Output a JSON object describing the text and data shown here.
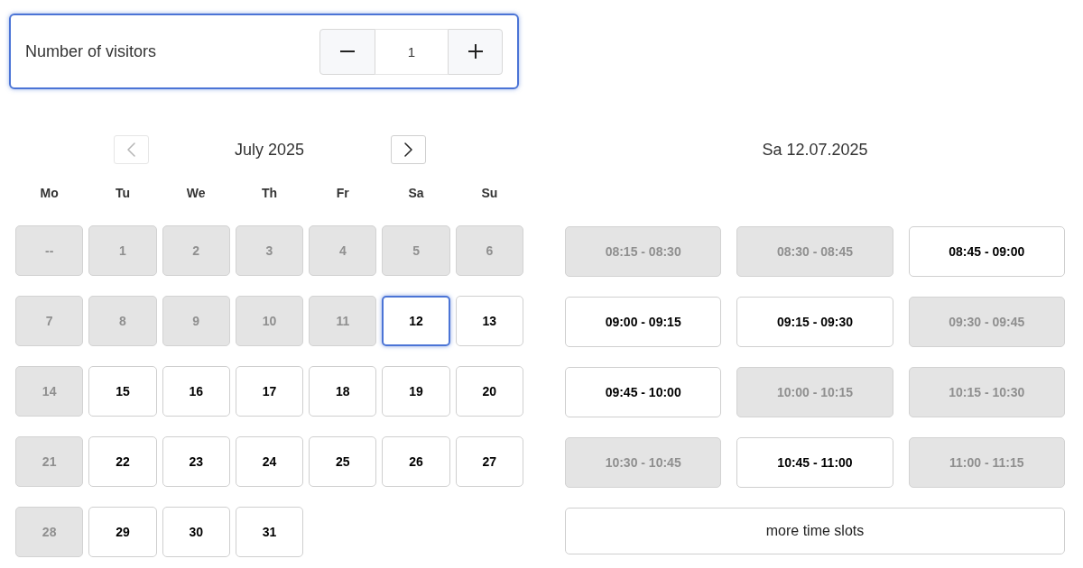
{
  "visitors": {
    "label": "Number of visitors",
    "value": "1",
    "focused": true
  },
  "calendar": {
    "month": "July 2025",
    "prev_disabled": true,
    "next_disabled": false,
    "weekdays": [
      "Mo",
      "Tu",
      "We",
      "Th",
      "Fr",
      "Sa",
      "Su"
    ],
    "weeks": [
      [
        {
          "label": "--",
          "disabled": true,
          "selected": false
        },
        {
          "label": "1",
          "disabled": true,
          "selected": false
        },
        {
          "label": "2",
          "disabled": true,
          "selected": false
        },
        {
          "label": "3",
          "disabled": true,
          "selected": false
        },
        {
          "label": "4",
          "disabled": true,
          "selected": false
        },
        {
          "label": "5",
          "disabled": true,
          "selected": false
        },
        {
          "label": "6",
          "disabled": true,
          "selected": false
        }
      ],
      [
        {
          "label": "7",
          "disabled": true,
          "selected": false
        },
        {
          "label": "8",
          "disabled": true,
          "selected": false
        },
        {
          "label": "9",
          "disabled": true,
          "selected": false
        },
        {
          "label": "10",
          "disabled": true,
          "selected": false
        },
        {
          "label": "11",
          "disabled": true,
          "selected": false
        },
        {
          "label": "12",
          "disabled": false,
          "selected": true
        },
        {
          "label": "13",
          "disabled": false,
          "selected": false
        }
      ],
      [
        {
          "label": "14",
          "disabled": true,
          "selected": false
        },
        {
          "label": "15",
          "disabled": false,
          "selected": false
        },
        {
          "label": "16",
          "disabled": false,
          "selected": false
        },
        {
          "label": "17",
          "disabled": false,
          "selected": false
        },
        {
          "label": "18",
          "disabled": false,
          "selected": false
        },
        {
          "label": "19",
          "disabled": false,
          "selected": false
        },
        {
          "label": "20",
          "disabled": false,
          "selected": false
        }
      ],
      [
        {
          "label": "21",
          "disabled": true,
          "selected": false
        },
        {
          "label": "22",
          "disabled": false,
          "selected": false
        },
        {
          "label": "23",
          "disabled": false,
          "selected": false
        },
        {
          "label": "24",
          "disabled": false,
          "selected": false
        },
        {
          "label": "25",
          "disabled": false,
          "selected": false
        },
        {
          "label": "26",
          "disabled": false,
          "selected": false
        },
        {
          "label": "27",
          "disabled": false,
          "selected": false
        }
      ],
      [
        {
          "label": "28",
          "disabled": true,
          "selected": false
        },
        {
          "label": "29",
          "disabled": false,
          "selected": false
        },
        {
          "label": "30",
          "disabled": false,
          "selected": false
        },
        {
          "label": "31",
          "disabled": false,
          "selected": false
        }
      ]
    ]
  },
  "slots": {
    "date": "Sa 12.07.2025",
    "items": [
      {
        "label": "08:15 - 08:30",
        "disabled": true
      },
      {
        "label": "08:30 - 08:45",
        "disabled": true
      },
      {
        "label": "08:45 - 09:00",
        "disabled": false
      },
      {
        "label": "09:00 - 09:15",
        "disabled": false
      },
      {
        "label": "09:15 - 09:30",
        "disabled": false
      },
      {
        "label": "09:30 - 09:45",
        "disabled": true
      },
      {
        "label": "09:45 - 10:00",
        "disabled": false
      },
      {
        "label": "10:00 - 10:15",
        "disabled": true
      },
      {
        "label": "10:15 - 10:30",
        "disabled": true
      },
      {
        "label": "10:30 - 10:45",
        "disabled": true
      },
      {
        "label": "10:45 - 11:00",
        "disabled": false
      },
      {
        "label": "11:00 - 11:15",
        "disabled": true
      }
    ],
    "more": "more time slots"
  }
}
